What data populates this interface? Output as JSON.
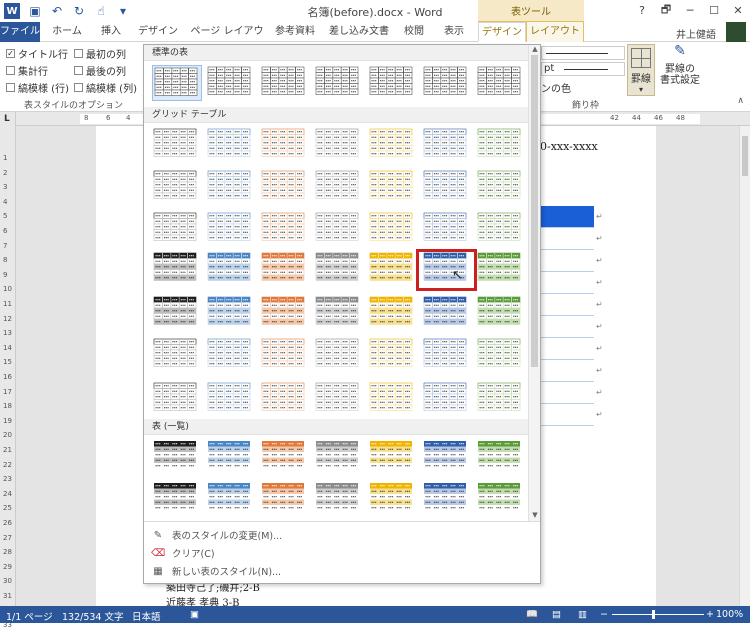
{
  "title": "名簿(before).docx - Word",
  "context_tab_group": "表ツール",
  "window": {
    "help": "?",
    "restore": "🗗",
    "minimize": "─",
    "maximize": "☐",
    "close": "✕"
  },
  "tabs": {
    "file": "ファイル",
    "home": "ホーム",
    "insert": "挿入",
    "design": "デザイン",
    "page_layout": "ページ レイアウト",
    "references": "参考資料",
    "mailings": "差し込み文書",
    "review": "校閲",
    "view": "表示",
    "table_design": "デザイン",
    "table_layout": "レイアウト"
  },
  "user": {
    "name": "井上健語"
  },
  "ribbon": {
    "options": {
      "header_row": "タイトル行",
      "first_column": "最初の列",
      "total_row": "集計行",
      "last_column": "最後の列",
      "banded_rows": "縞模様 (行)",
      "banded_columns": "縞模様 (列)",
      "group_label": "表スタイルのオプション"
    },
    "borders": {
      "weight_unit": "pt",
      "pen_color": "ンの色",
      "borders_btn": "罫線",
      "border_painter_line1": "罫線の",
      "border_painter_line2": "書式設定",
      "group_label": "飾り枠"
    }
  },
  "ruler": {
    "tab_selector": "L",
    "top_numbers": [
      "8",
      "6",
      "4",
      "42",
      "44",
      "46",
      "48"
    ],
    "right_numbers_pos": [],
    "left_numbers": [
      "1",
      "2",
      "3",
      "4",
      "5",
      "6",
      "7",
      "8",
      "9",
      "10",
      "11",
      "12",
      "13",
      "14",
      "15",
      "16",
      "17",
      "18",
      "19",
      "20",
      "21",
      "22",
      "23",
      "24",
      "25",
      "26",
      "27",
      "28",
      "29",
      "30",
      "31",
      "32",
      "33"
    ]
  },
  "gallery": {
    "sections": {
      "plain": "標準の表",
      "grid": "グリッド テーブル",
      "list": "表 (一覧)"
    },
    "footer": {
      "modify": "表のスタイルの変更(M)...",
      "clear": "クリア(C)",
      "new": "新しい表のスタイル(N)..."
    },
    "colors": [
      "#1f1f1f",
      "#4a86c6",
      "#e07a3c",
      "#8c8c8c",
      "#f0b400",
      "#2f5eaa",
      "#5b9b3a"
    ],
    "light_colors": [
      "#bfbfbf",
      "#bdd3ec",
      "#f5c8aa",
      "#d0d0d0",
      "#f7e08f",
      "#b7c9e6",
      "#c3dfb0"
    ]
  },
  "document": {
    "phone": "0-xxx-xxxx",
    "line1": "築田寺己了;磯井;2-B",
    "line2": "近藤孝 孝典 3-B"
  },
  "status": {
    "page": "1/1 ページ",
    "words": "132/534 文字",
    "language": "日本語",
    "zoom": "100%"
  }
}
